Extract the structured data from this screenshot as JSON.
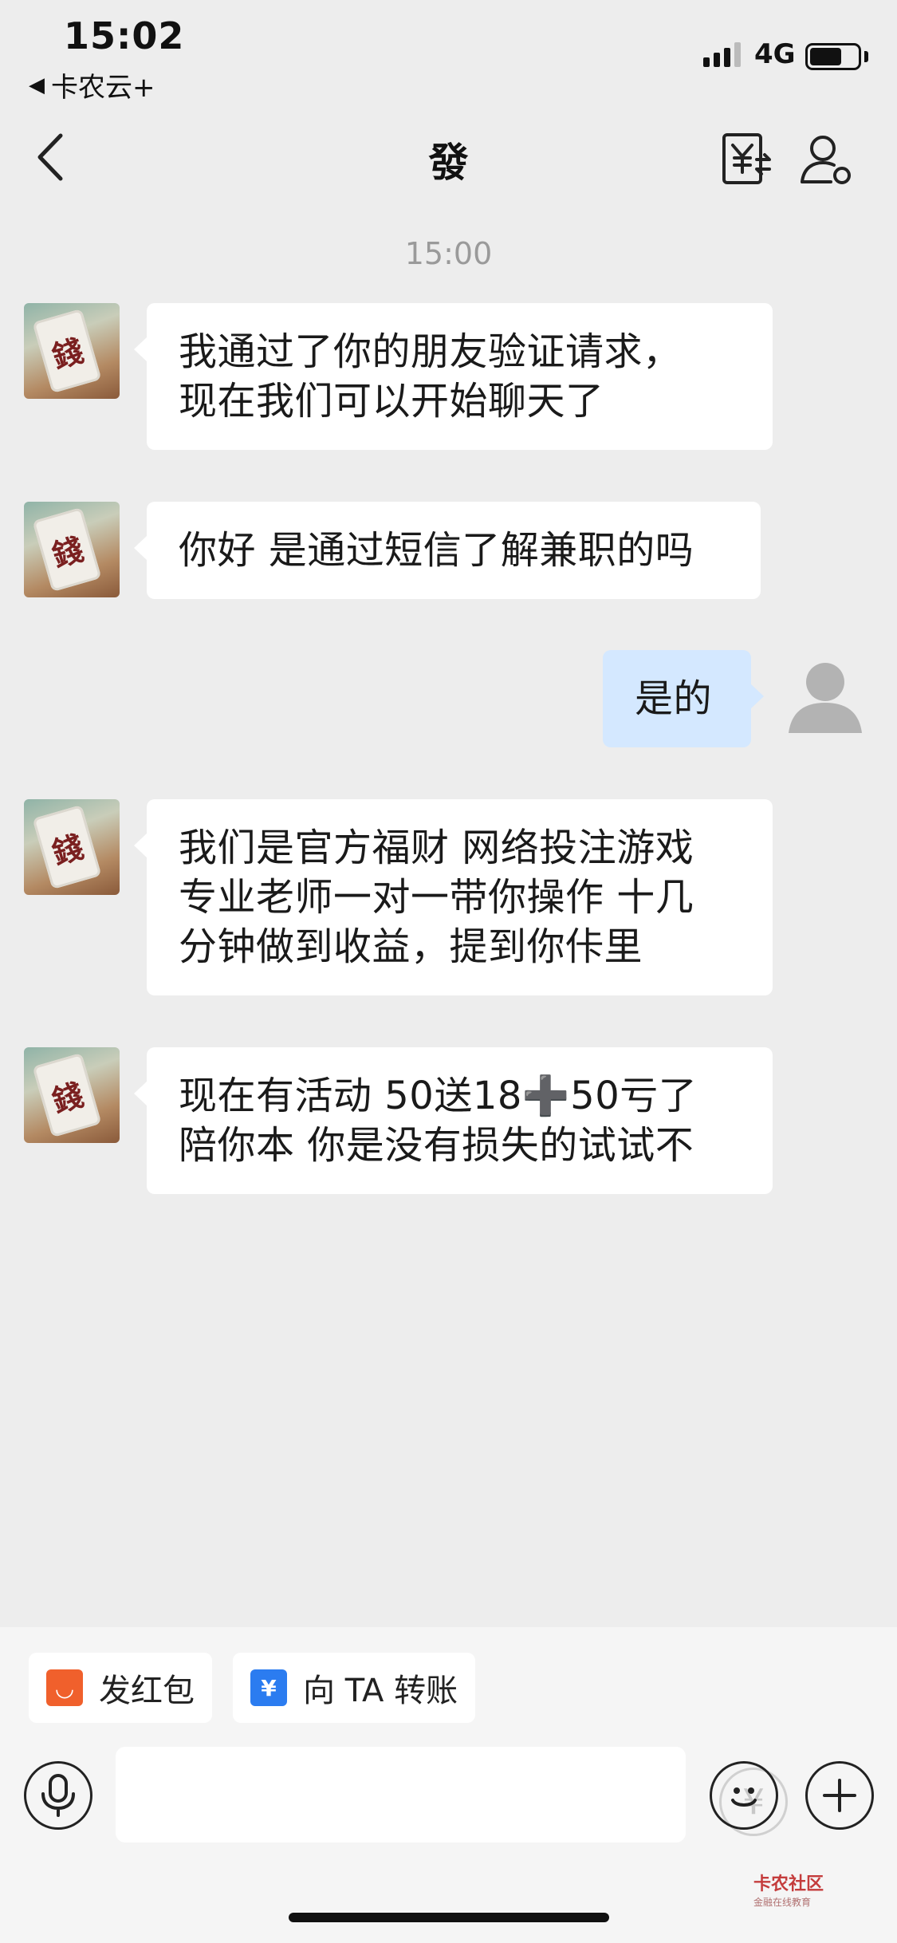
{
  "status_bar": {
    "time": "15:02",
    "back_app": "卡农云+",
    "network": "4G",
    "battery_level": 0.68
  },
  "nav": {
    "title": "發"
  },
  "chat": {
    "timestamp": "15:00",
    "messages": [
      {
        "side": "left",
        "text": "我通过了你的朋友验证请求，\n现在我们可以开始聊天了"
      },
      {
        "side": "left",
        "text": "你好 是通过短信了解兼职的吗"
      },
      {
        "side": "right",
        "text": "是的"
      },
      {
        "side": "left",
        "text": "我们是官方福财 网络投注游戏\n专业老师一对一带你操作 十几\n分钟做到收益，提到你佧里"
      },
      {
        "side": "left",
        "text": "现在有活动 50送18➕50亏了\n陪你本 你是没有损失的试试不"
      }
    ],
    "contact_avatar_text": "錢"
  },
  "quick_actions": {
    "red_packet": "发红包",
    "transfer": "向 TA 转账"
  },
  "input": {
    "placeholder": "",
    "money_icon": "¥"
  },
  "watermark": {
    "brand": "卡农社区",
    "tagline": "金融在线教育"
  },
  "colors": {
    "background": "#ededed",
    "bubble_left": "#ffffff",
    "bubble_right": "#d4e8ff",
    "red_packet_icon": "#f0602c",
    "transfer_icon": "#2b7cf0"
  },
  "icons": {
    "back": "chevron-left-icon",
    "transfer_nav": "yuan-transfer-icon",
    "profile": "person-settings-icon",
    "voice": "microphone-icon",
    "emoji": "smiley-icon",
    "more": "plus-icon"
  }
}
